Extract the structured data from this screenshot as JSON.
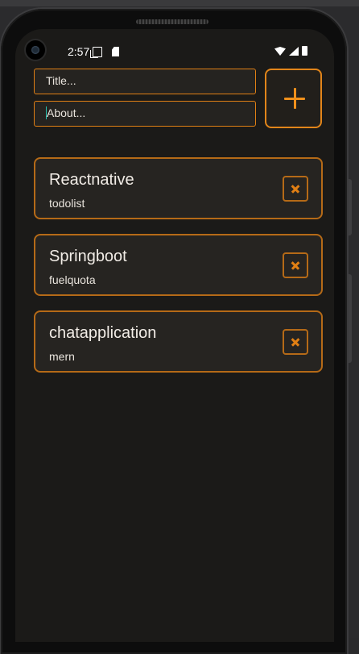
{
  "status_bar": {
    "time": "2:57",
    "left_icons": [
      "screen-copy-icon",
      "sd-card-icon"
    ],
    "right_icons": [
      "wifi-icon",
      "cell-signal-icon",
      "battery-icon"
    ]
  },
  "form": {
    "title_placeholder": "Title...",
    "about_placeholder": "About...",
    "title_value": "",
    "about_value": "",
    "add_button_icon": "plus-icon"
  },
  "todos": [
    {
      "title": "Reactnative",
      "subtitle": "todolist"
    },
    {
      "title": "Springboot",
      "subtitle": "fuelquota"
    },
    {
      "title": "chatapplication",
      "subtitle": "mern"
    }
  ],
  "colors": {
    "accent": "#e07f14",
    "background": "#1b1a18",
    "card_background": "#262421",
    "text": "#f1ece6"
  }
}
